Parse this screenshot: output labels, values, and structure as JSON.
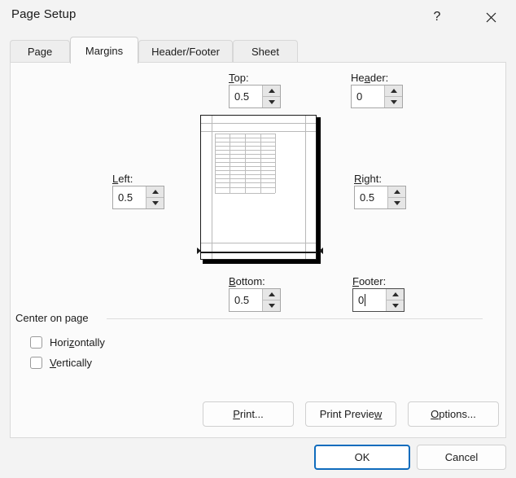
{
  "window": {
    "title": "Page Setup",
    "help_icon": "question-mark-icon",
    "close_icon": "close-icon"
  },
  "tabs": [
    {
      "label": "Page",
      "active": false
    },
    {
      "label": "Margins",
      "active": true
    },
    {
      "label": "Header/Footer",
      "active": false
    },
    {
      "label": "Sheet",
      "active": false
    }
  ],
  "margins": {
    "top": {
      "label": "Top:",
      "value": "0.5",
      "accelerator": "T",
      "focused": false
    },
    "header": {
      "label": "Header:",
      "value": "0",
      "accelerator": "a",
      "focused": false
    },
    "left": {
      "label": "Left:",
      "value": "0.5",
      "accelerator": "L",
      "focused": false
    },
    "right": {
      "label": "Right:",
      "value": "0.5",
      "accelerator": "R",
      "focused": false
    },
    "bottom": {
      "label": "Bottom:",
      "value": "0.5",
      "accelerator": "B",
      "focused": false
    },
    "footer": {
      "label": "Footer:",
      "value": "0",
      "accelerator": "F",
      "focused": true
    }
  },
  "preview": {
    "name": "page-margin-preview",
    "grid_rows": 14,
    "grid_columns": 4
  },
  "center_on_page": {
    "title": "Center on page",
    "options": [
      {
        "label": "Horizontally",
        "checked": false
      },
      {
        "label": "Vertically",
        "checked": false
      }
    ]
  },
  "action_buttons": [
    {
      "label": "Print...",
      "name": "print-button"
    },
    {
      "label": "Print Preview",
      "name": "print-preview-button"
    },
    {
      "label": "Options...",
      "name": "options-button"
    }
  ],
  "footer_buttons": {
    "ok": "OK",
    "cancel": "Cancel"
  },
  "colors": {
    "accent": "#0f6cbd",
    "dialog_bg": "#f3f3f3",
    "panel_bg": "#fbfbfb",
    "text": "#1b1b1b"
  }
}
